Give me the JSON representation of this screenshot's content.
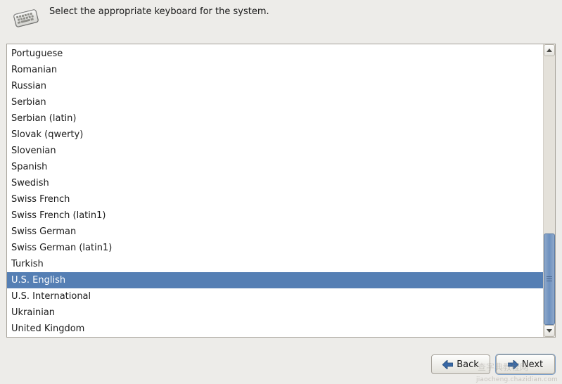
{
  "header": {
    "instruction": "Select the appropriate keyboard for the system."
  },
  "keyboards": {
    "selected": "U.S. English",
    "items": [
      "Portuguese",
      "Romanian",
      "Russian",
      "Serbian",
      "Serbian (latin)",
      "Slovak (qwerty)",
      "Slovenian",
      "Spanish",
      "Swedish",
      "Swiss French",
      "Swiss French (latin1)",
      "Swiss German",
      "Swiss German (latin1)",
      "Turkish",
      "U.S. English",
      "U.S. International",
      "Ukrainian",
      "United Kingdom"
    ]
  },
  "buttons": {
    "back": "Back",
    "next": "Next"
  },
  "watermark": {
    "site": "jiaocheng.chazidian.com",
    "stamp": "查字典教程网"
  }
}
